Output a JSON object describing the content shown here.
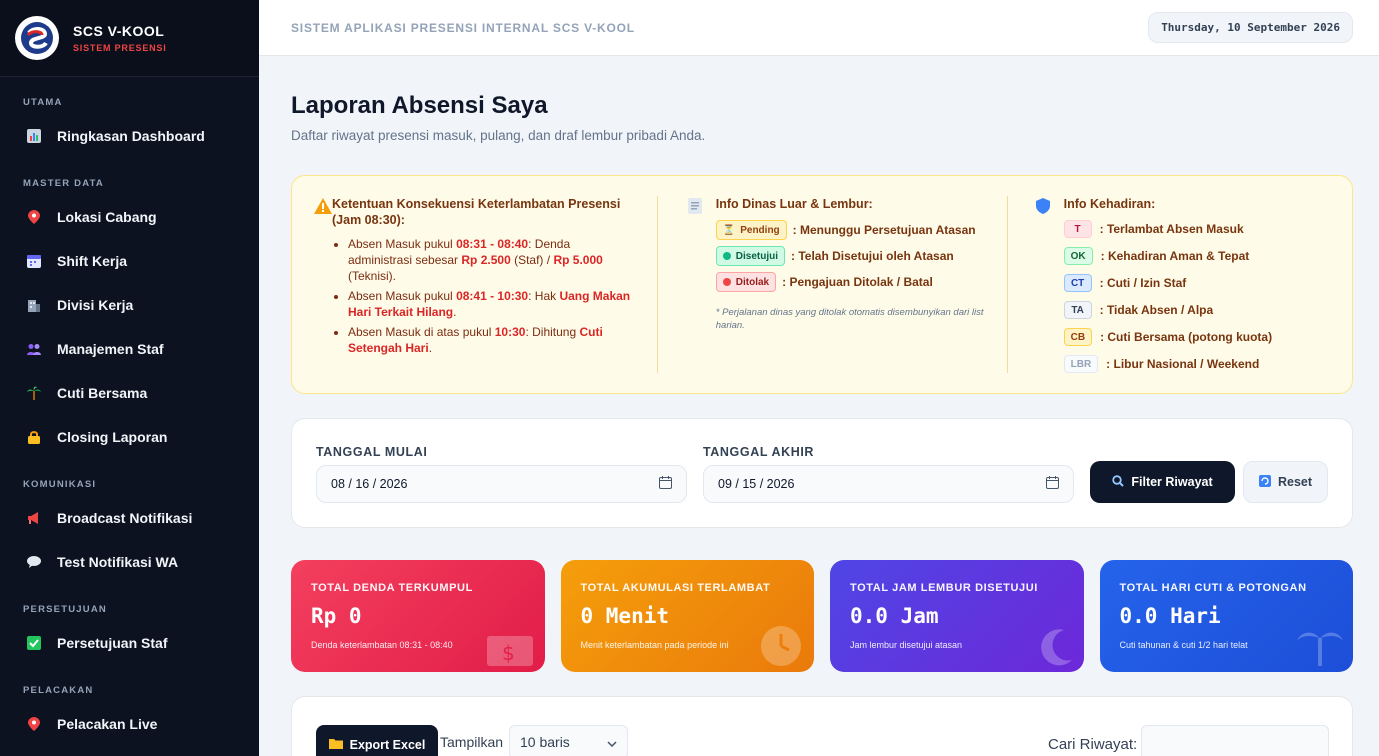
{
  "brand": {
    "title": "SCS V-KOOL",
    "subtitle": "SISTEM PRESENSI"
  },
  "sidebar": {
    "sections": [
      {
        "title": "UTAMA",
        "items": [
          {
            "label": "Ringkasan Dashboard",
            "icon": "bar-chart-icon"
          }
        ]
      },
      {
        "title": "MASTER DATA",
        "items": [
          {
            "label": "Lokasi Cabang",
            "icon": "pin-icon"
          },
          {
            "label": "Shift Kerja",
            "icon": "calendar-icon"
          },
          {
            "label": "Divisi Kerja",
            "icon": "building-icon"
          },
          {
            "label": "Manajemen Staf",
            "icon": "users-icon"
          },
          {
            "label": "Cuti Bersama",
            "icon": "palm-icon"
          },
          {
            "label": "Closing Laporan",
            "icon": "lock-icon"
          }
        ]
      },
      {
        "title": "KOMUNIKASI",
        "items": [
          {
            "label": "Broadcast Notifikasi",
            "icon": "megaphone-icon"
          },
          {
            "label": "Test Notifikasi WA",
            "icon": "chat-icon"
          }
        ]
      },
      {
        "title": "PERSETUJUAN",
        "items": [
          {
            "label": "Persetujuan Staf",
            "icon": "check-icon"
          }
        ]
      },
      {
        "title": "PELACAKAN",
        "items": [
          {
            "label": "Pelacakan Live",
            "icon": "pin-icon"
          }
        ]
      }
    ]
  },
  "topbar": {
    "title": "SISTEM APLIKASI PRESENSI INTERNAL SCS V-KOOL",
    "date": "Thursday, 10 September 2026"
  },
  "page": {
    "title": "Laporan Absensi Saya",
    "subtitle": "Daftar riwayat presensi masuk, pulang, dan draf lembur pribadi Anda."
  },
  "info": {
    "lateness": {
      "title": "Ketentuan Konsekuensi Keterlambatan Presensi (Jam 08:30):",
      "r1_a": "Absen Masuk pukul ",
      "r1_b": "08:31 - 08:40",
      "r1_c": ": Denda administrasi sebesar ",
      "r1_d": "Rp 2.500",
      "r1_e": " (Staf) / ",
      "r1_f": "Rp 5.000",
      "r1_g": " (Teknisi).",
      "r2_a": "Absen Masuk pukul ",
      "r2_b": "08:41 - 10:30",
      "r2_c": ": Hak ",
      "r2_d": "Uang Makan Hari Terkait Hilang",
      "r2_e": ".",
      "r3_a": "Absen Masuk di atas pukul ",
      "r3_b": "10:30",
      "r3_c": ": Dihitung ",
      "r3_d": "Cuti Setengah Hari",
      "r3_e": "."
    },
    "dinas": {
      "title": "Info Dinas Luar & Lembur:",
      "pending_badge": "Pending",
      "pending_text": ": Menunggu Persetujuan Atasan",
      "approved_badge": "Disetujui",
      "approved_text": ": Telah Disetujui oleh Atasan",
      "rejected_badge": "Ditolak",
      "rejected_text": ": Pengajuan Ditolak / Batal",
      "note": "* Perjalanan dinas yang ditolak otomatis disembunyikan dari list harian."
    },
    "kehadiran": {
      "title": "Info Kehadiran:",
      "codes": [
        {
          "code": "T",
          "text": ": Terlambat Absen Masuk"
        },
        {
          "code": "OK",
          "text": ": Kehadiran Aman & Tepat"
        },
        {
          "code": "CT",
          "text": ": Cuti / Izin Staf"
        },
        {
          "code": "TA",
          "text": ": Tidak Absen / Alpa"
        },
        {
          "code": "CB",
          "text": ": Cuti Bersama (potong kuota)"
        },
        {
          "code": "LBR",
          "text": ": Libur Nasional / Weekend"
        }
      ]
    }
  },
  "filter": {
    "start_label": "TANGGAL MULAI",
    "start_value": "08 / 16 / 2026",
    "end_label": "TANGGAL AKHIR",
    "end_value": "09 / 15 / 2026",
    "filter_button": "Filter Riwayat",
    "reset_button": "Reset"
  },
  "stats": [
    {
      "label": "TOTAL DENDA TERKUMPUL",
      "value": "Rp 0",
      "sub": "Denda keterlambatan 08:31 - 08:40",
      "color": "#e11d48"
    },
    {
      "label": "TOTAL AKUMULASI TERLAMBAT",
      "value": "0 Menit",
      "sub": "Menit keterlambatan pada periode ini",
      "color": "#f59e0b"
    },
    {
      "label": "TOTAL JAM LEMBUR DISETUJUI",
      "value": "0.0 Jam",
      "sub": "Jam lembur disetujui atasan",
      "color": "#4f46e5"
    },
    {
      "label": "TOTAL HARI CUTI & POTONGAN",
      "value": "0.0 Hari",
      "sub": "Cuti tahunan & cuti 1/2 hari telat",
      "color": "#2563eb"
    }
  ],
  "table": {
    "export_button": "Export Excel",
    "show_label": "Tampilkan",
    "show_value": "10 baris",
    "search_label": "Cari Riwayat:"
  }
}
